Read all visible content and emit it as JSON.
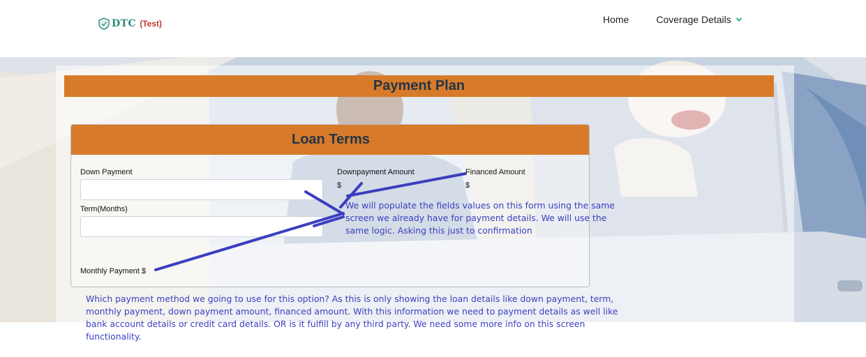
{
  "brand": {
    "name": "DTC",
    "tag": "(Test)",
    "icon": "shield-logo-icon"
  },
  "nav": {
    "home": "Home",
    "coverage": "Coverage Details",
    "coverage_icon": "chevron-down-icon"
  },
  "plan": {
    "title": "Payment Plan"
  },
  "loan_terms": {
    "title": "Loan Terms",
    "down_payment_label": "Down Payment",
    "down_payment_value": "",
    "term_label": "Term(Months)",
    "term_value": "",
    "monthly_payment_label": "Monthly Payment $",
    "downpayment_amount_label": "Downpayment Amount",
    "downpayment_amount_value": "$",
    "financed_amount_label": "Financed Amount",
    "financed_amount_value": "$"
  },
  "annotations": {
    "note1_lines": [
      "We will populate the fields values on this form using the same",
      "screen we already have for payment details. We will use the",
      "same logic. Asking this just to confirmation"
    ],
    "note2_lines": [
      "Which payment method we going to use for this option? As this is only showing the loan details like down payment, term,",
      "monthly payment, down payment amount, financed amount. With this information we need to payment details as well like",
      "bank account details or credit card details. OR is it fulfill by any third party. We need some more info on this screen",
      "functionality."
    ]
  },
  "colors": {
    "accent_orange": "#d77b2a",
    "heading_navy": "#243447",
    "annotation_blue": "#3a3fbf",
    "brand_teal": "#2e8b7a",
    "brand_red": "#c0392b"
  }
}
